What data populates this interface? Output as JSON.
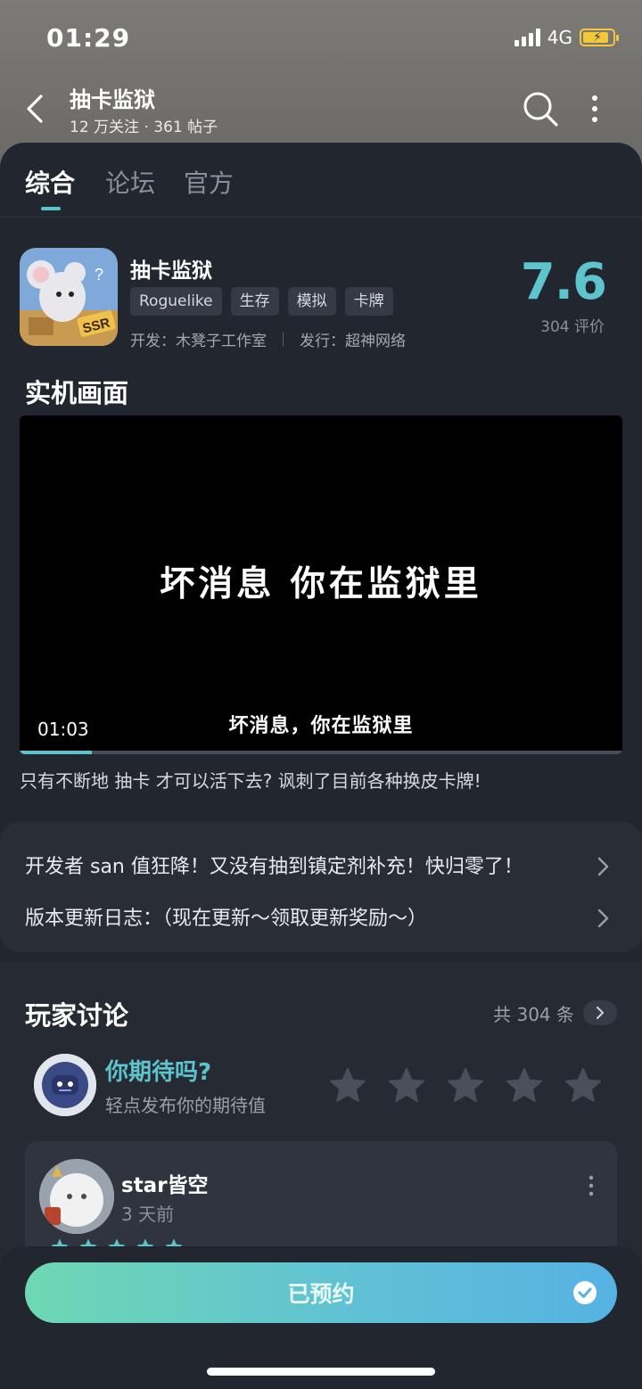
{
  "status_bar": {
    "time": "01:29",
    "network": "4G"
  },
  "nav": {
    "title": "抽卡监狱",
    "subtitle": "12 万关注 · 361 帖子"
  },
  "tabs": [
    {
      "label": "综合",
      "active": true
    },
    {
      "label": "论坛",
      "active": false
    },
    {
      "label": "官方",
      "active": false
    }
  ],
  "game": {
    "name": "抽卡监狱",
    "tags": [
      "Roguelike",
      "生存",
      "模拟",
      "卡牌"
    ],
    "developer": "开发：木凳子工作室",
    "publisher": "发行：超神网络",
    "score": "7.6",
    "score_count": "304 评价"
  },
  "screenshots": {
    "title": "实机画面",
    "video_main_text": "坏消息 你在监狱里",
    "video_subtitle": "坏消息，你在监狱里",
    "video_time": "01:03",
    "progress": 0.12,
    "caption": "只有不断地 抽卡 才可以活下去? 讽刺了目前各种换皮卡牌!"
  },
  "news": [
    {
      "text": "开发者 san 值狂降！又没有抽到镇定剂补充！快归零了！"
    },
    {
      "text": "版本更新日志：（现在更新～领取更新奖励～）"
    }
  ],
  "discussion": {
    "title": "玩家讨论",
    "count": "共 304 条",
    "expect_title": "你期待吗?",
    "expect_sub": "轻点发布你的期待值",
    "stars": 5,
    "review": {
      "user": "star皆空",
      "time": "3 天前",
      "rating": 5
    }
  },
  "bottom": {
    "reserve_label": "已预约"
  },
  "colors": {
    "accent": "#5dc3cc",
    "background": "#22262f",
    "header": "#74726e"
  }
}
